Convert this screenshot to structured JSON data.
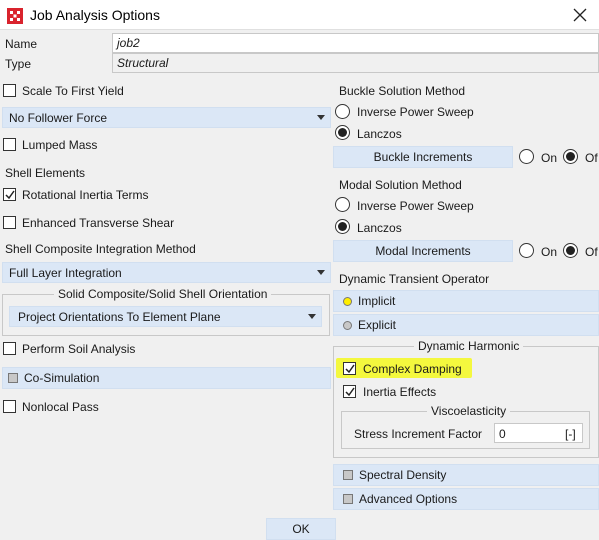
{
  "window": {
    "title": "Job Analysis Options"
  },
  "name_field": {
    "label": "Name",
    "value": "job2"
  },
  "type_field": {
    "label": "Type",
    "value": "Structural"
  },
  "left": {
    "scale_first_yield": {
      "label": "Scale To First Yield",
      "checked": false
    },
    "follower_force": {
      "value": "No Follower Force"
    },
    "lumped_mass": {
      "label": "Lumped Mass",
      "checked": false
    },
    "shell_elements_heading": "Shell Elements",
    "rotational_inertia": {
      "label": "Rotational Inertia Terms",
      "checked": true
    },
    "enhanced_shear": {
      "label": "Enhanced Transverse Shear",
      "checked": false
    },
    "shell_composite_heading": "Shell Composite Integration Method",
    "shell_composite_value": "Full Layer Integration",
    "solid_composite_group_title": "Solid Composite/Solid Shell Orientation",
    "solid_composite_value": "Project Orientations To Element Plane",
    "soil_analysis": {
      "label": "Perform Soil Analysis",
      "checked": false
    },
    "co_simulation": "Co-Simulation",
    "nonlocal_pass": {
      "label": "Nonlocal Pass",
      "checked": false
    }
  },
  "right": {
    "buckle_heading": "Buckle Solution Method",
    "buckle_options": [
      "Inverse Power Sweep",
      "Lanczos"
    ],
    "buckle_selected": "Lanczos",
    "buckle_increments": "Buckle Increments",
    "buckle_on": "On",
    "buckle_off": "Of",
    "modal_heading": "Modal Solution Method",
    "modal_options": [
      "Inverse Power Sweep",
      "Lanczos"
    ],
    "modal_selected": "Lanczos",
    "modal_increments": "Modal Increments",
    "modal_on": "On",
    "modal_off": "Of",
    "dynamic_transient_heading": "Dynamic Transient Operator",
    "implicit": "Implicit",
    "explicit": "Explicit",
    "dynamic_harmonic_title": "Dynamic Harmonic",
    "complex_damping": {
      "label": "Complex Damping",
      "checked": true
    },
    "inertia_effects": {
      "label": "Inertia Effects",
      "checked": true
    },
    "viscoelasticity_title": "Viscoelasticity",
    "stress_increment_label": "Stress Increment Factor",
    "stress_increment_value": "0",
    "stress_increment_unit": "[-]",
    "spectral_density": "Spectral Density",
    "advanced_options": "Advanced Options"
  },
  "footer": {
    "ok": "OK"
  },
  "colors": {
    "accent_panel": "#dbe7f6",
    "highlight": "#f4f83e",
    "implicit_dot": "#ffee00"
  }
}
